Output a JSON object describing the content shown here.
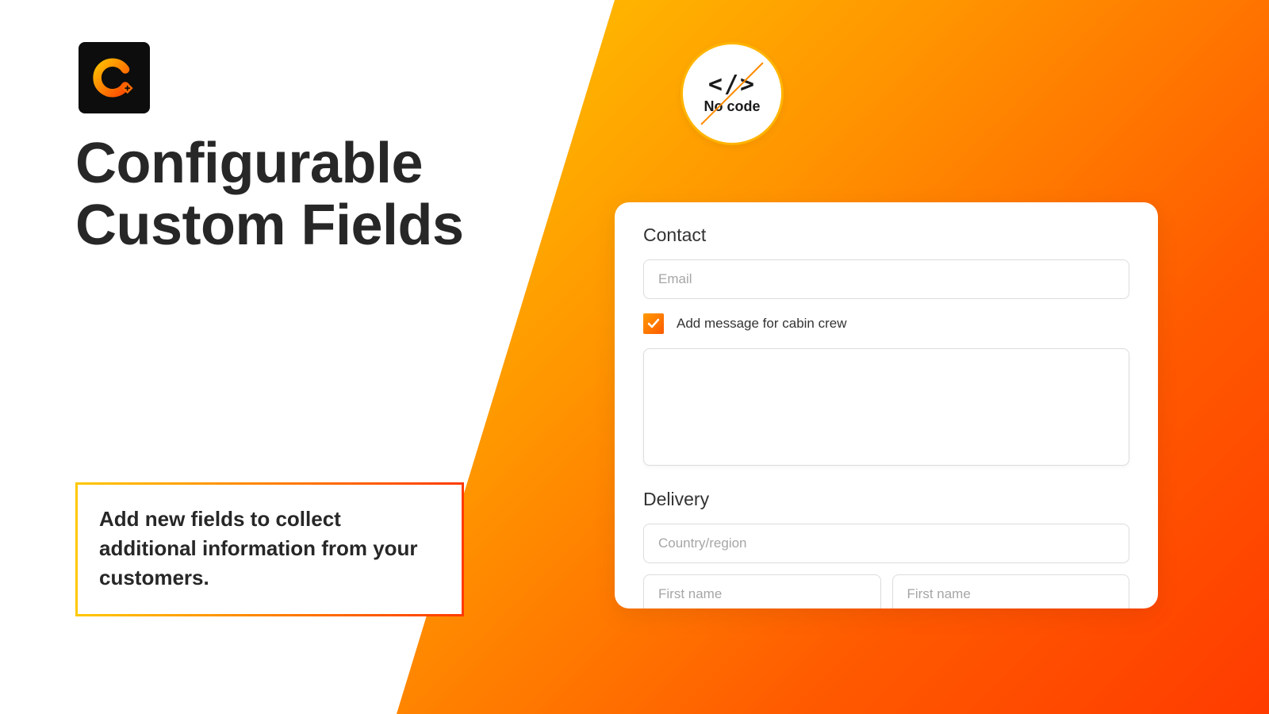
{
  "title": {
    "line1": "Configurable",
    "line2": "Custom Fields"
  },
  "callout": "Add new fields to collect additional information from your customers.",
  "badge": {
    "code_glyph": "</>",
    "label": "No code"
  },
  "form": {
    "contact": {
      "heading": "Contact",
      "email_placeholder": "Email",
      "checkbox_label": "Add message for cabin crew",
      "checkbox_checked": true,
      "textarea_value": ""
    },
    "delivery": {
      "heading": "Delivery",
      "country_placeholder": "Country/region",
      "first_name_placeholder": "First name",
      "last_name_placeholder": "First name"
    }
  }
}
